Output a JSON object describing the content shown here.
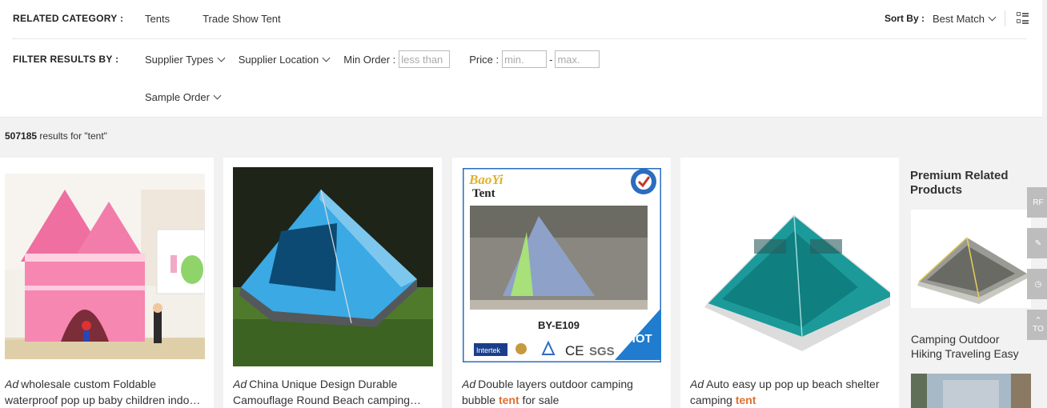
{
  "filters": {
    "related_label": "RELATED CATEGORY :",
    "related_links": [
      "Tents",
      "Trade Show Tent"
    ],
    "sort_label": "Sort By :",
    "sort_value": "Best Match",
    "filter_label": "FILTER RESULTS BY :",
    "supplier_types": "Supplier Types",
    "supplier_location": "Supplier Location",
    "min_order_label": "Min Order :",
    "min_order_placeholder": "less than",
    "price_label": "Price :",
    "price_min_placeholder": "min.",
    "price_dash": "-",
    "price_max_placeholder": "max.",
    "sample_order": "Sample Order"
  },
  "results": {
    "count": "507185",
    "text": "results for \"tent\""
  },
  "products": [
    {
      "ad": "Ad",
      "title_a": "wholesale custom Foldable waterproof pop up baby children indo…",
      "highlight": "",
      "title_b": ""
    },
    {
      "ad": "Ad",
      "title_a": "China Unique Design Durable Camouflage Round Beach camping…",
      "highlight": "",
      "title_b": ""
    },
    {
      "ad": "Ad",
      "title_a": "Double layers outdoor camping bubble ",
      "highlight": "tent",
      "title_b": " for sale"
    },
    {
      "ad": "Ad",
      "title_a": "Auto easy up pop up beach shelter camping ",
      "highlight": "tent",
      "title_b": ""
    }
  ],
  "product_images": {
    "baoyi_brand": "BaoYi",
    "baoyi_sub": "Tent",
    "model": "BY-E109",
    "hot": "HOT",
    "cert_intertek": "Intertek",
    "cert_ce": "CE",
    "cert_sgs": "SGS"
  },
  "premium": {
    "heading": "Premium Related Products",
    "item_title": "Camping Outdoor Hiking Traveling Easy"
  },
  "side_tools": [
    {
      "icon": "rfq-icon",
      "label": "RF"
    },
    {
      "icon": "edit-icon",
      "label": ""
    },
    {
      "icon": "history-icon",
      "label": ""
    },
    {
      "icon": "to-top-icon",
      "label": "TO"
    }
  ],
  "colors": {
    "highlight": "#e0702d",
    "panel_bg": "#ffffff",
    "page_bg": "#f2f2f2"
  }
}
